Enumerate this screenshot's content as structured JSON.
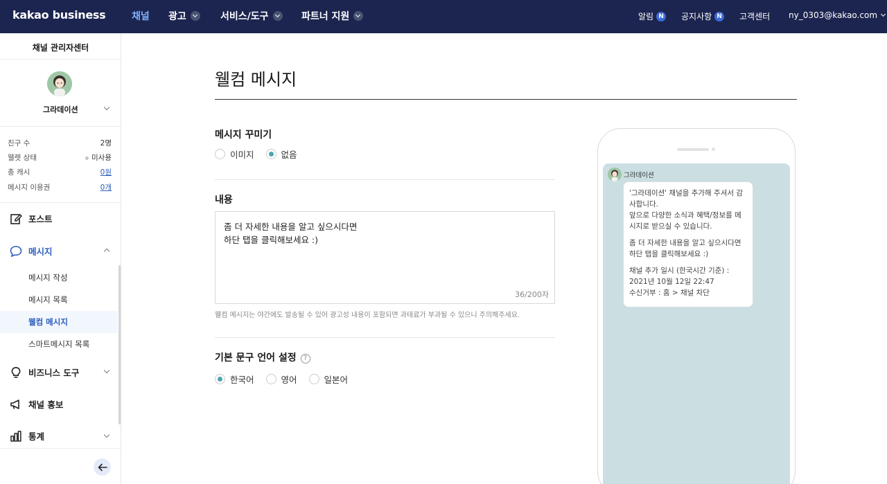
{
  "header": {
    "logo": "kakao business",
    "nav": [
      {
        "label": "채널",
        "active": true,
        "dropdown": false
      },
      {
        "label": "광고",
        "active": false,
        "dropdown": true
      },
      {
        "label": "서비스/도구",
        "active": false,
        "dropdown": true
      },
      {
        "label": "파트너 지원",
        "active": false,
        "dropdown": true
      }
    ],
    "alerts_label": "알림",
    "alerts_badge": "N",
    "notices_label": "공지사항",
    "notices_badge": "N",
    "support_label": "고객센터",
    "account": "ny_0303@kakao.com"
  },
  "sidebar": {
    "title": "채널 관리자센터",
    "channel_name": "그라데이션",
    "stats": [
      {
        "label": "친구 수",
        "value": "2명"
      },
      {
        "label": "웰렛 상태",
        "value": "미사용"
      },
      {
        "label": "총 캐시",
        "value": "0원"
      },
      {
        "label": "메시지 이용권",
        "value": "0개"
      }
    ],
    "menu": {
      "post": "포스트",
      "message": "메시지",
      "message_sub": [
        "메시지 작성",
        "메시지 목록",
        "웰컴 메시지",
        "스마트메시지 목록"
      ],
      "business_tools": "비즈니스 도구",
      "promotion": "채널 홍보",
      "stats": "통계"
    }
  },
  "main": {
    "title": "웰컴 메시지",
    "decorate_label": "메시지 꾸미기",
    "decorate_options": [
      "이미지",
      "없음"
    ],
    "decorate_selected": "없음",
    "content_label": "내용",
    "content_value": "좀 더 자세한 내용을 알고 싶으시다면\n하단 탭을 클릭해보세요 :)",
    "counter": "36/200자",
    "notice": "웰컴 메시지는 야간에도 발송될 수 있어 광고성 내용이 포함되면 과태료가 부과될 수 있으니 주의해주세요.",
    "language_label": "기본 문구 언어 설정",
    "language_options": [
      "한국어",
      "영어",
      "일본어"
    ],
    "language_selected": "한국어"
  },
  "preview": {
    "sender": "그라데이션",
    "para1": "'그라데이션' 채널을 추가해 주셔서 감사합니다.\n앞으로 다양한 소식과 혜택/정보를 메시지로 받으실 수 있습니다.",
    "para2": "좀 더 자세한 내용을 알고 싶으시다면\n하단 탭을 클릭해보세요 :)",
    "para3": "채널 추가 일시 (한국시간 기준) :\n2021년 10월 12일 22:47\n수신거부 : 홈 > 채널 차단"
  },
  "colors": {
    "header_bg": "#1c2550",
    "nav_active": "#7fb4ff",
    "accent_blue": "#2c5ebd",
    "radio_teal": "#4aa6b0",
    "preview_bg": "#cbdfe3"
  }
}
